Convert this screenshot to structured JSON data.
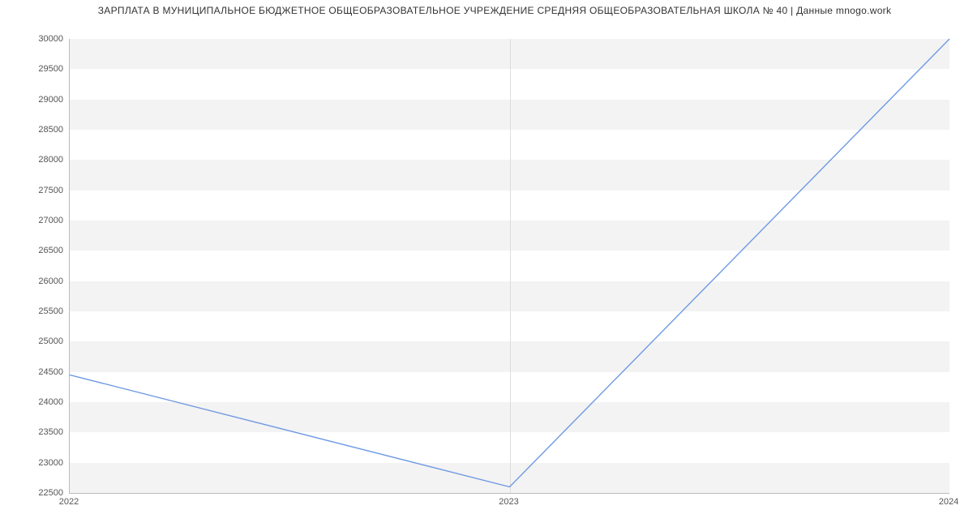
{
  "chart_data": {
    "type": "line",
    "title": "ЗАРПЛАТА В МУНИЦИПАЛЬНОЕ БЮДЖЕТНОЕ ОБЩЕОБРАЗОВАТЕЛЬНОЕ УЧРЕЖДЕНИЕ СРЕДНЯЯ ОБЩЕОБРАЗОВАТЕЛЬНАЯ ШКОЛА № 40 | Данные mnogo.work",
    "x": [
      "2022",
      "2023",
      "2024"
    ],
    "values": [
      24450,
      22600,
      30000
    ],
    "xlabel": "",
    "ylabel": "",
    "ylim": [
      22500,
      30000
    ],
    "y_ticks": [
      22500,
      23000,
      23500,
      24000,
      24500,
      25000,
      25500,
      26000,
      26500,
      27000,
      27500,
      28000,
      28500,
      29000,
      29500,
      30000
    ],
    "line_color": "#6f9ae3"
  }
}
